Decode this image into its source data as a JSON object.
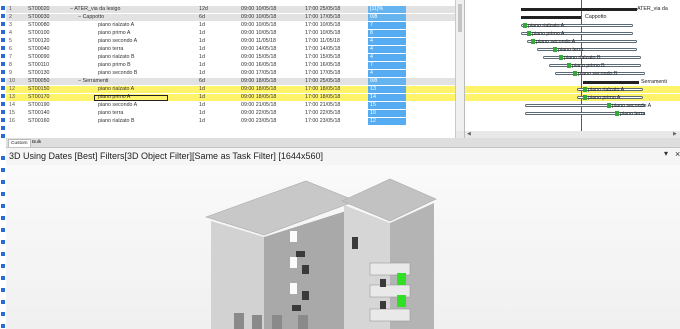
{
  "task_grid": {
    "rows": [
      {
        "num": "1",
        "id": "ST00020",
        "name": "− ATER_via da lesigo",
        "duration": "12d",
        "start": "09:00 10/05/18",
        "end": "17:00 25/05/18",
        "progress": "[11]%",
        "style": "summary"
      },
      {
        "num": "2",
        "id": "ST00030",
        "name": "− Cappotto",
        "duration": "6d",
        "start": "09:00 10/05/18",
        "end": "17:00 17/05/18",
        "progress": "0/8",
        "style": "summary"
      },
      {
        "num": "3",
        "id": "ST00080",
        "name": "piano rialzato A",
        "duration": "1d",
        "start": "09:00 10/05/18",
        "end": "17:00 10/05/18",
        "progress": "7",
        "style": "normal"
      },
      {
        "num": "4",
        "id": "ST00100",
        "name": "piano primo A",
        "duration": "1d",
        "start": "09:00 10/05/18",
        "end": "17:00 10/05/18",
        "progress": "8",
        "style": "normal"
      },
      {
        "num": "5",
        "id": "ST00120",
        "name": "piano secondo A",
        "duration": "1d",
        "start": "09:00 11/05/18",
        "end": "17:00 11/05/18",
        "progress": "4",
        "style": "normal"
      },
      {
        "num": "6",
        "id": "ST00040",
        "name": "piano terra",
        "duration": "1d",
        "start": "09:00 14/05/18",
        "end": "17:00 14/05/18",
        "progress": "4",
        "style": "normal"
      },
      {
        "num": "7",
        "id": "ST00090",
        "name": "piano rialzato B",
        "duration": "1d",
        "start": "09:00 15/05/18",
        "end": "17:00 15/05/18",
        "progress": "4",
        "style": "normal"
      },
      {
        "num": "8",
        "id": "ST00110",
        "name": "piano primo B",
        "duration": "1d",
        "start": "09:00 16/05/18",
        "end": "17:00 16/05/18",
        "progress": "7",
        "style": "normal"
      },
      {
        "num": "9",
        "id": "ST00130",
        "name": "piano secondo B",
        "duration": "1d",
        "start": "09:00 17/05/18",
        "end": "17:00 17/05/18",
        "progress": "4",
        "style": "normal"
      },
      {
        "num": "10",
        "id": "ST00050",
        "name": "− Serramenti",
        "duration": "6d",
        "start": "09:00 18/05/18",
        "end": "17:00 25/05/18",
        "progress": "0/8",
        "style": "summary"
      },
      {
        "num": "12",
        "id": "ST00150",
        "name": "piano rialzato A",
        "duration": "1d",
        "start": "09:00 18/05/18",
        "end": "17:00 18/05/18",
        "progress": "13",
        "style": "highlight"
      },
      {
        "num": "13",
        "id": "ST00170",
        "name": "piano primo A",
        "duration": "1d",
        "start": "09:00 18/05/18",
        "end": "17:00 18/05/18",
        "progress": "14",
        "style": "highlight"
      },
      {
        "num": "14",
        "id": "ST00190",
        "name": "piano secondo A",
        "duration": "1d",
        "start": "09:00 21/05/18",
        "end": "17:00 21/05/18",
        "progress": "15",
        "style": "normal"
      },
      {
        "num": "15",
        "id": "ST00140",
        "name": "piano terra",
        "duration": "1d",
        "start": "09:00 22/05/18",
        "end": "17:00 22/05/18",
        "progress": "10",
        "style": "normal"
      },
      {
        "num": "16",
        "id": "ST00160",
        "name": "piano rialzato B",
        "duration": "1d",
        "start": "09:00 23/05/18",
        "end": "17:00 23/05/18",
        "progress": "12",
        "style": "normal"
      }
    ]
  },
  "gantt": {
    "labels": {
      "project": "ATER_via da",
      "cappotto": "Cappotto",
      "serramenti": "Serramenti",
      "r3": "piano rialzato A",
      "r4": "piano primo A",
      "r5": "piano secondo A",
      "r6": "piano terra",
      "r7": "piano rialzato B",
      "r8": "piano primo B",
      "r9": "piano secondo B",
      "r12": "piano rialzato A",
      "r13": "piano primo A",
      "r14": "piano secondo A",
      "r15": "piano terra"
    }
  },
  "tabs": [
    {
      "label": "Custom"
    },
    {
      "label": "Bulk"
    }
  ],
  "view": {
    "title": "3D Using Dates [Best] Filters[3D Object Filter][Same as Task Filter] [1644x560]",
    "menu_glyph": "▾",
    "close_glyph": "×"
  },
  "colors": {
    "highlight": "#fff36a",
    "progress": "#55acf2",
    "milestone_icon": "#35a83a",
    "window_green": "#2fe024",
    "today_line": "#dd2222"
  }
}
